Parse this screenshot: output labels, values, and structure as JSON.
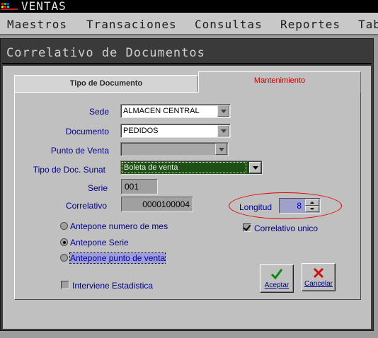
{
  "app": {
    "title": "VENTAS"
  },
  "menu": {
    "items": [
      "Maestros",
      "Transaciones",
      "Consultas",
      "Reportes",
      "Tab"
    ]
  },
  "dialog": {
    "title": "Correlativo de Documentos",
    "tabs": [
      "Tipo de Documento",
      "Mantenimiento"
    ],
    "fields": {
      "sede": {
        "label": "Sede",
        "value": "ALMACEN CENTRAL"
      },
      "documento": {
        "label": "Documento",
        "value": "PEDIDOS"
      },
      "punto_venta": {
        "label": "Punto de Venta",
        "value": ""
      },
      "tipo_doc_sunat": {
        "label": "Tipo de Doc. Sunat",
        "value": "Boleta de venta"
      },
      "serie": {
        "label": "Serie",
        "value": "001"
      },
      "correlativo": {
        "label": "Correlativo",
        "value": "0000100004"
      },
      "longitud": {
        "label": "Longitud",
        "value": "8"
      }
    },
    "options": {
      "antepone_mes": {
        "label": "Antepone numero de mes",
        "checked": false
      },
      "antepone_serie": {
        "label": "Antepone Serie",
        "checked": true
      },
      "antepone_punto": {
        "label": "Antepone punto de venta",
        "checked": false
      },
      "correlativo_unico": {
        "label": "Correlativo unico",
        "checked": true
      },
      "interviene_estadistica": {
        "label": "Interviene Estadistica",
        "checked": false
      }
    },
    "buttons": {
      "aceptar": "Aceptar",
      "cancelar": "Cancelar"
    }
  },
  "colors": {
    "label": "#00008b",
    "active_tab": "#c00000",
    "selected_combo": "#1e4f14",
    "annotation": "#e00000"
  }
}
